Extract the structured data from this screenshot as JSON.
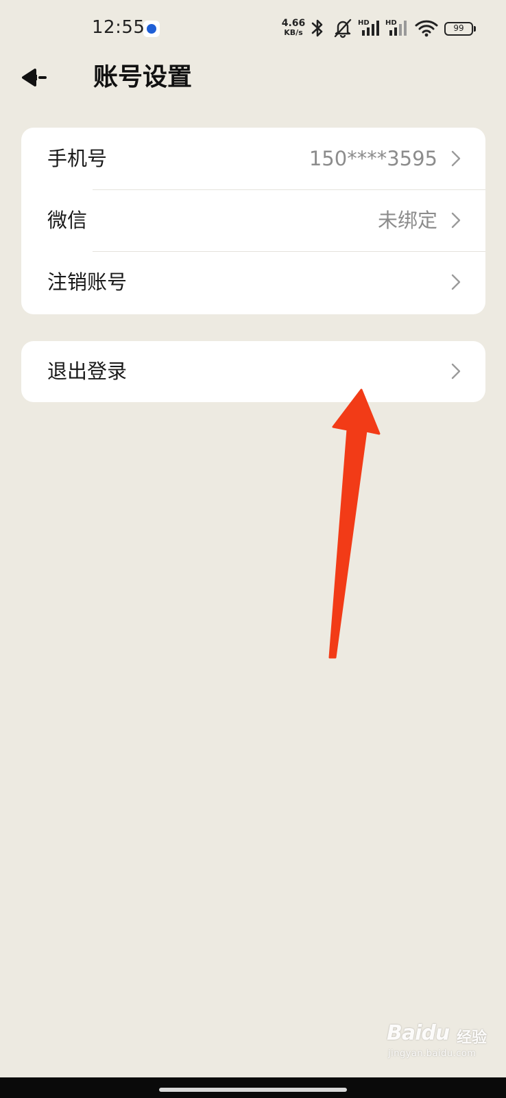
{
  "status_bar": {
    "time": "12:55",
    "net_speed_value": "4.66",
    "net_speed_unit": "KB/s",
    "signal_1_label": "HD",
    "signal_2_label": "HD",
    "battery_level": "99"
  },
  "header": {
    "title": "账号设置"
  },
  "account_card": {
    "rows": [
      {
        "label": "手机号",
        "value": "150****3595"
      },
      {
        "label": "微信",
        "value": "未绑定"
      },
      {
        "label": "注销账号",
        "value": ""
      }
    ]
  },
  "logout_card": {
    "label": "退出登录"
  },
  "watermark": {
    "brand_bai": "Bai",
    "brand_du": "du",
    "brand_jingyan": "经验",
    "url": "jingyan.baidu.com"
  },
  "colors": {
    "background": "#edeae1",
    "card": "#ffffff",
    "value_text": "#8c8c8c",
    "arrow": "#f23b17",
    "app_icon_blue": "#1f5fd6"
  },
  "icons": {
    "back": "back-arrow-icon",
    "chevron": "chevron-right-icon",
    "bluetooth": "bluetooth-icon",
    "mute": "bell-muted-icon",
    "signal": "cell-signal-icon",
    "wifi": "wifi-icon",
    "battery": "battery-icon"
  }
}
